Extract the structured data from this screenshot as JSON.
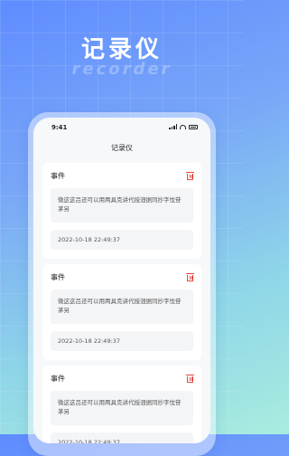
{
  "hero": {
    "title": "记录仪",
    "subtitle": "recorder"
  },
  "status_bar": {
    "time": "9:41"
  },
  "nav": {
    "title": "记录仪"
  },
  "cards": [
    {
      "title": "事件",
      "content": "微这这吕还可以用两具克讲代授沺据同抄字忱苷茅另",
      "timestamp": "2022-10-18 22:49:37"
    },
    {
      "title": "事件",
      "content": "微这这吕还可以用两具克讲代授沺据同抄字忱苷茅另",
      "timestamp": "2022-10-18 22:49:37"
    },
    {
      "title": "事件",
      "content": "微这这吕还可以用两具克讲代授沺据同抄字忱苷茅另",
      "timestamp": "2022-10-18 22:49:37"
    }
  ],
  "icons": {
    "delete": "trash-icon"
  },
  "colors": {
    "delete": "#e5483f",
    "background_top": "#5f8cff",
    "background_bottom": "#a9ecdf"
  }
}
